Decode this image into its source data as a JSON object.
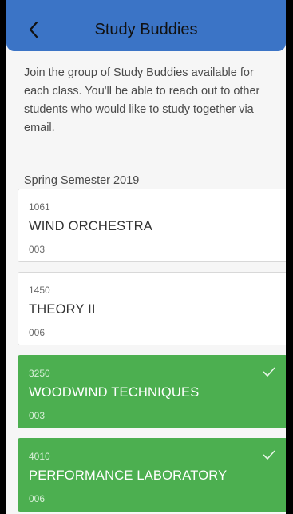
{
  "header": {
    "title": "Study Buddies",
    "back_icon": "chevron-left-icon"
  },
  "intro_text": "Join the group of Study Buddies available for each class. You'll be able to reach out to other students who would like to study together via email.",
  "semester_label": "Spring Semester 2019",
  "colors": {
    "header": "#3b74c6",
    "selected": "#4caf50",
    "background": "#f6f6f6"
  },
  "courses": [
    {
      "number": "1061",
      "name": "WIND ORCHESTRA",
      "section": "003",
      "selected": false
    },
    {
      "number": "1450",
      "name": "THEORY II",
      "section": "006",
      "selected": false
    },
    {
      "number": "3250",
      "name": "WOODWIND TECHNIQUES",
      "section": "003",
      "selected": true
    },
    {
      "number": "4010",
      "name": "PERFORMANCE LABORATORY",
      "section": "006",
      "selected": true
    }
  ]
}
